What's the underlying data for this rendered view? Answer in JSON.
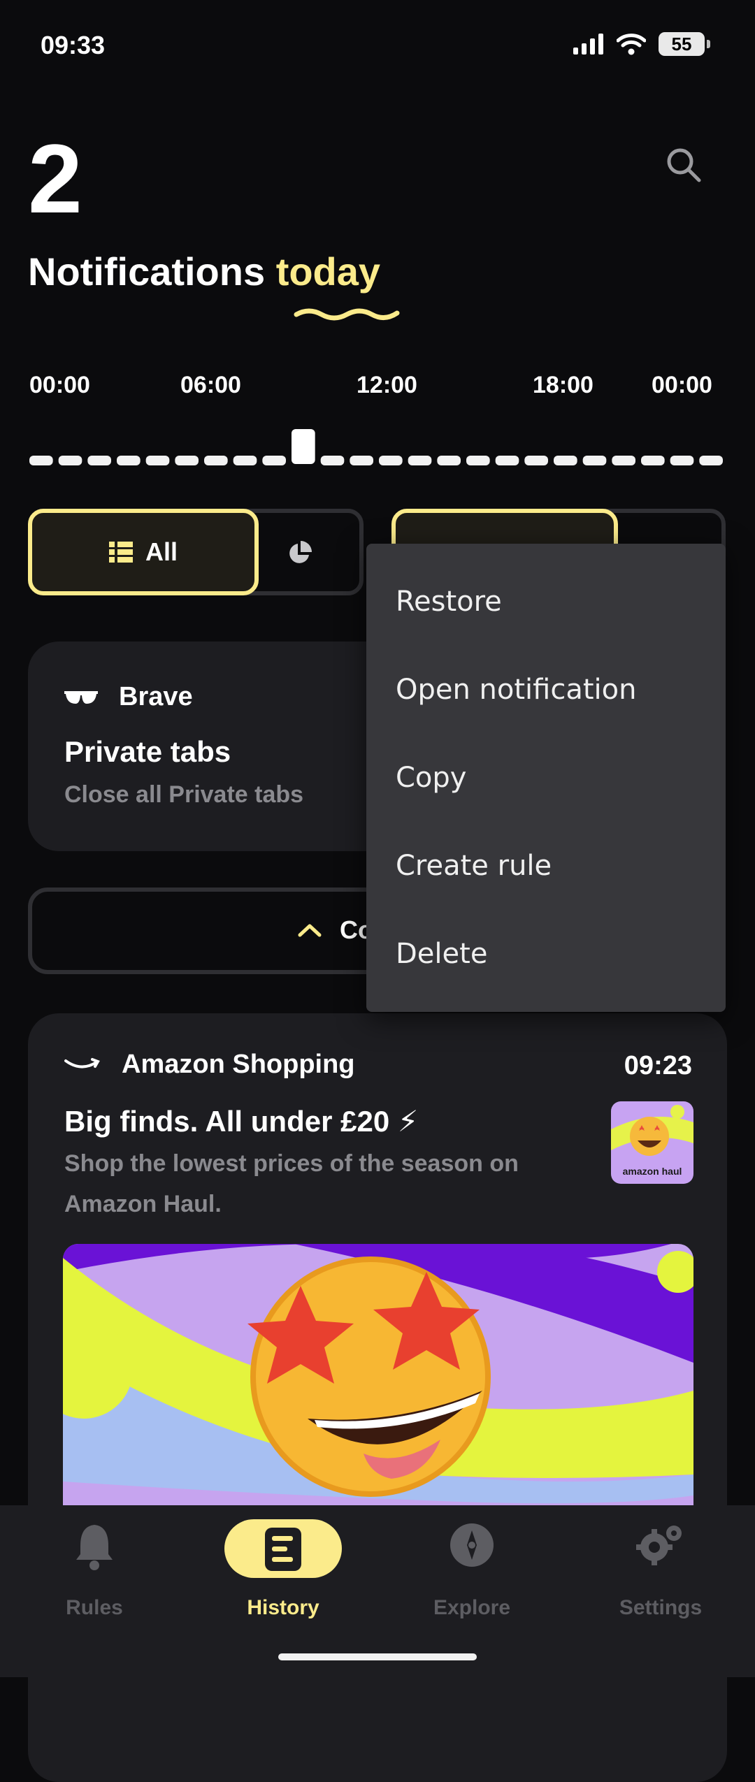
{
  "status_bar": {
    "time": "09:33",
    "battery": "55"
  },
  "header": {
    "count": "2",
    "title_prefix": "Notifications ",
    "title_highlight": "today"
  },
  "timeline": {
    "labels": [
      "00:00",
      "06:00",
      "12:00",
      "18:00",
      "00:00"
    ]
  },
  "filter": {
    "all_label": "All"
  },
  "notifications": [
    {
      "app": "Brave",
      "title": "Private tabs",
      "body": "Close all Private tabs"
    },
    {
      "app": "Amazon Shopping",
      "time": "09:23",
      "title": "Big finds. All under £20 ⚡",
      "body": "Shop the lowest prices of the season on Amazon Haul.",
      "thumb_text": "amazon haul"
    }
  ],
  "collapse": {
    "label": "Co"
  },
  "context_menu": {
    "items": [
      "Restore",
      "Open notification",
      "Copy",
      "Create rule",
      "Delete"
    ]
  },
  "bottom_nav": {
    "items": [
      "Rules",
      "History",
      "Explore",
      "Settings"
    ],
    "active": "History"
  },
  "colors": {
    "accent": "#fbeb8b",
    "background": "#0b0b0d",
    "card": "#1d1d21",
    "menu": "#37373b"
  }
}
